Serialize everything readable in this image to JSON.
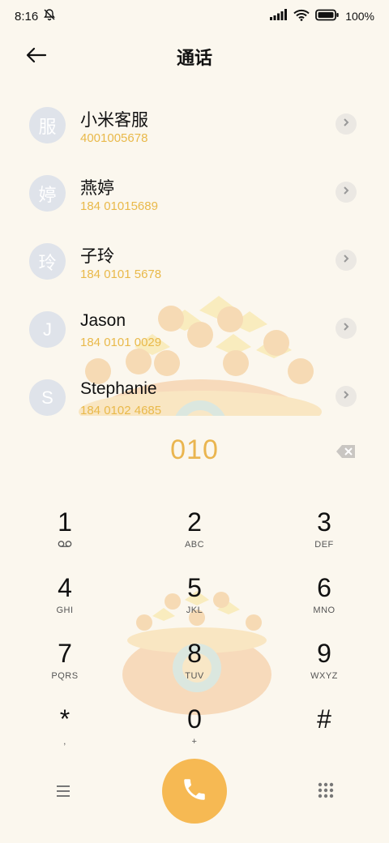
{
  "status_bar": {
    "time": "8:16",
    "battery_pct": "100%",
    "icons": [
      "bell-off-icon",
      "signal-icon",
      "wifi-icon",
      "battery-icon"
    ]
  },
  "header": {
    "title": "通话",
    "back_icon": "arrow-left-icon"
  },
  "contacts": [
    {
      "avatar": "服",
      "name": "小米客服",
      "number": "4001005678"
    },
    {
      "avatar": "婷",
      "name": "燕婷",
      "number": "184 01015689"
    },
    {
      "avatar": "玲",
      "name": "子玲",
      "number": "184 0101 5678"
    },
    {
      "avatar": "J",
      "name": "Jason",
      "number": "184 0101 0029"
    },
    {
      "avatar": "S",
      "name": "Stephanie",
      "number": "184 0102 4685"
    }
  ],
  "dial": {
    "number": "010"
  },
  "keypad": [
    {
      "digit": "1",
      "letters": ""
    },
    {
      "digit": "2",
      "letters": "ABC"
    },
    {
      "digit": "3",
      "letters": "DEF"
    },
    {
      "digit": "4",
      "letters": "GHI"
    },
    {
      "digit": "5",
      "letters": "JKL"
    },
    {
      "digit": "6",
      "letters": "MNO"
    },
    {
      "digit": "7",
      "letters": "PQRS"
    },
    {
      "digit": "8",
      "letters": "TUV"
    },
    {
      "digit": "9",
      "letters": "WXYZ"
    },
    {
      "digit": "*",
      "letters": ","
    },
    {
      "digit": "0",
      "letters": "+"
    },
    {
      "digit": "#",
      "letters": ""
    }
  ],
  "colors": {
    "accent": "#f6b953",
    "number_text": "#e9b94a",
    "background": "#fbf7ee",
    "avatar_bg": "#dfe3ea"
  }
}
